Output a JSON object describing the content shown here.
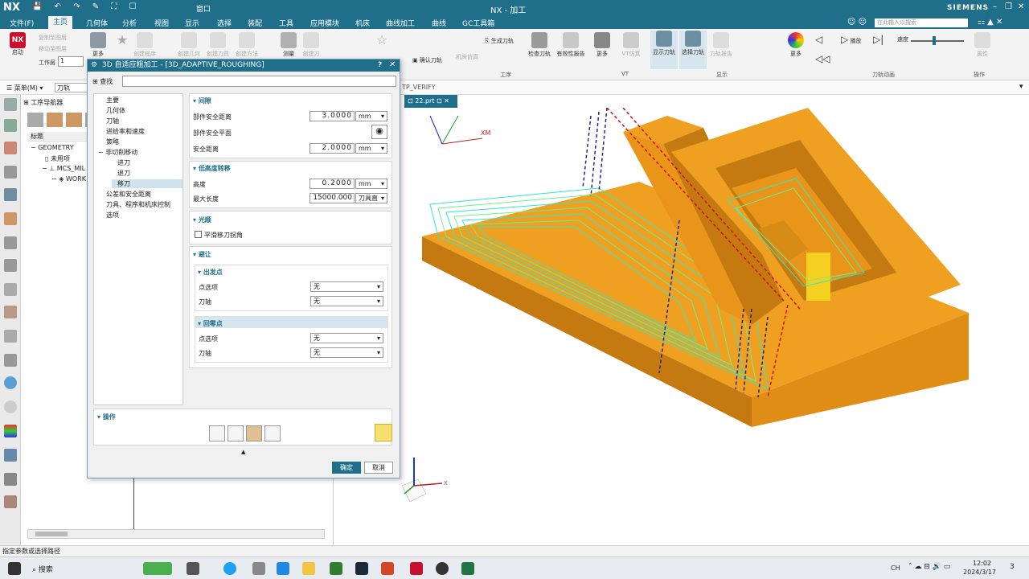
{
  "app": {
    "logo": "NX",
    "window_title": "NX - 加工",
    "brand": "SIEMENS",
    "window_menu": "窗口",
    "search_placeholder": "在此输入以搜索"
  },
  "menu": {
    "tabs": [
      "文件(F)",
      "主页",
      "几何体",
      "分析",
      "视图",
      "显示",
      "选择",
      "装配",
      "工具",
      "应用模块",
      "机床",
      "曲线加工",
      "曲线",
      "GC工具箱"
    ],
    "active_index": 1
  },
  "ribbon": {
    "buttons": [
      "启动",
      "创建刀轨",
      "创建几何体",
      "创建刀具",
      "更多",
      "测量",
      "创建方法",
      "创建程序",
      "生成刀轨",
      "确认刀轨",
      "机床仿真",
      "检查刀轨",
      "有效性报告",
      "VT仿真",
      "显示刀轨",
      "选择刀轨",
      "刀轨报告",
      "播放",
      "速度",
      "属性"
    ],
    "groups": [
      "工序",
      "VT",
      "显示",
      "刀轨动画",
      "操作"
    ],
    "layer_label": "工作层",
    "layer_value": "1",
    "small_items": [
      "复制至图层",
      "移动至图层"
    ]
  },
  "toolbar2": {
    "menu": "菜单(M)",
    "filter": "刀轨",
    "verify": "TP_VERIFY"
  },
  "navigator": {
    "title": "工序导航器",
    "column": "标题",
    "tree": [
      "GEOMETRY",
      "未用项",
      "MCS_MIL",
      "WORK"
    ]
  },
  "viewport": {
    "tab": "22.prt",
    "axis_xm": "XM",
    "axis_x": "X"
  },
  "dialog": {
    "title": "3D 自适应粗加工 - [3D_ADAPTIVE_ROUGHING]",
    "help": "?",
    "close": "✕",
    "find_label": "查找",
    "find_value": "",
    "tree": [
      "主要",
      "几何体",
      "刀轴",
      "进给率和速度",
      "策略",
      "非切削移动",
      "进刀",
      "退刀",
      "移刀",
      "公差和安全距离",
      "刀具、程序和机床控制",
      "选项"
    ],
    "selected_tree_index": 8,
    "sections": {
      "clearance": {
        "title": "间隙",
        "part_safe_dist": "部件安全距离",
        "part_safe_dist_value": "3.0000",
        "part_safe_dist_unit": "mm",
        "part_safe_plane": "部件安全平面",
        "safe_dist": "安全距离",
        "safe_dist_value": "2.0000",
        "safe_dist_unit": "mm"
      },
      "low_height": {
        "title": "低高度转移",
        "height": "高度",
        "height_value": "0.2000",
        "height_unit": "mm",
        "max_length": "最大长度",
        "max_length_value": "15000.000",
        "max_length_unit": "刀具直"
      },
      "smooth": {
        "title": "光顺",
        "checkbox": "平滑移刀拐角",
        "checked": false
      },
      "avoid": {
        "title": "避让",
        "from": {
          "title": "出发点",
          "point": "点选项",
          "point_value": "无",
          "axis": "刀轴",
          "axis_value": "无"
        },
        "home": {
          "title": "回零点",
          "point": "点选项",
          "point_value": "无",
          "axis": "刀轴",
          "axis_value": "无"
        }
      }
    },
    "ops_title": "操作",
    "ok": "确定",
    "cancel": "取消"
  },
  "status": {
    "text": "指定参数或选择路径"
  },
  "taskbar": {
    "search": "搜索",
    "lang": "CH",
    "time": "12:02",
    "date": "2024/3/17",
    "notif": "3"
  }
}
